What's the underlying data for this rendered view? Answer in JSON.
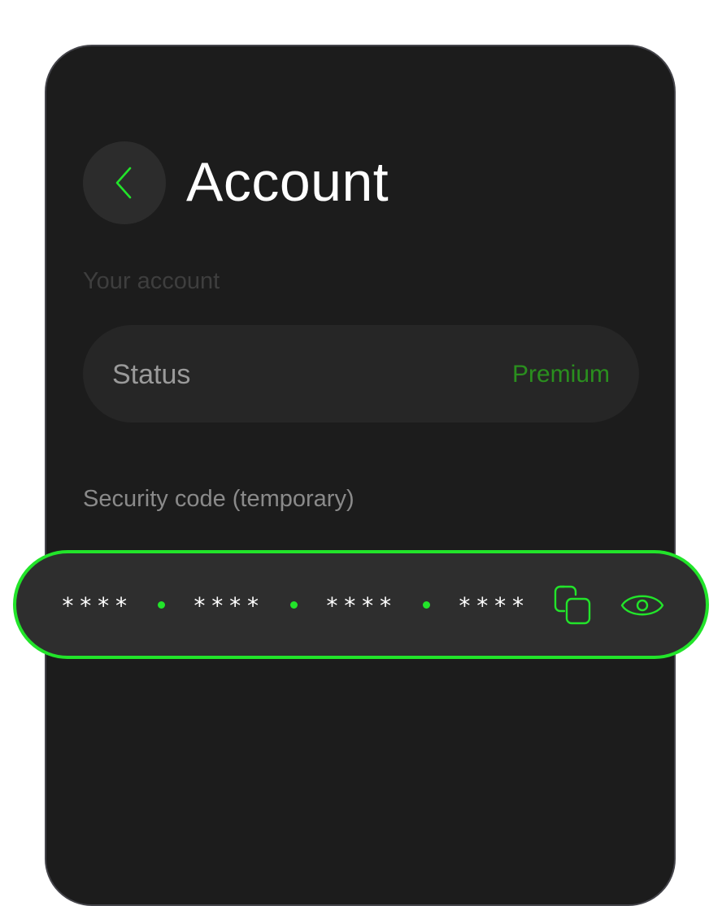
{
  "header": {
    "title": "Account",
    "back_icon": "chevron-left-icon"
  },
  "account_section": {
    "label": "Your account",
    "status_label": "Status",
    "status_value": "Premium"
  },
  "security_section": {
    "label": "Security code (temporary)",
    "code_groups": [
      "****",
      "****",
      "****",
      "****"
    ],
    "copy_icon": "copy-icon",
    "reveal_icon": "eye-icon"
  },
  "colors": {
    "accent": "#22e42a",
    "premium": "#2a8f1e",
    "background": "#1c1c1c",
    "card": "#262626"
  }
}
